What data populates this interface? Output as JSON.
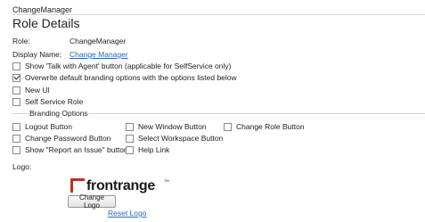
{
  "app_name": "ChangeManager",
  "page_title": "Role Details",
  "role": {
    "label": "Role:",
    "value": "ChangeManager"
  },
  "display_name": {
    "label": "Display Name:",
    "value": "Change Manager"
  },
  "options": [
    {
      "label": "Show 'Talk with Agent' button (applicable for SelfService only)",
      "checked": false
    },
    {
      "label": "Overwrite default branding options with the options listed below",
      "checked": true
    },
    {
      "label": "New UI",
      "checked": false
    },
    {
      "label": "Self Service Role",
      "checked": false
    }
  ],
  "branding": {
    "legend": "Branding Options",
    "col1": [
      {
        "label": "Logout Button",
        "checked": false
      },
      {
        "label": "Change Password Button",
        "checked": false
      },
      {
        "label": "Show \"Report an Issue\" button",
        "checked": false
      }
    ],
    "col2": [
      {
        "label": "New Window Button",
        "checked": false
      },
      {
        "label": "Select Workspace Button",
        "checked": false
      },
      {
        "label": "Help Link",
        "checked": false
      }
    ],
    "col3": [
      {
        "label": "Change Role Button",
        "checked": false
      }
    ]
  },
  "logo": {
    "label": "Logo:",
    "brand_text": "frontrange",
    "brand_mark": "TM",
    "brand_color": "#c0301f",
    "change_button": "Change Logo",
    "reset_link": "Reset Logo"
  }
}
